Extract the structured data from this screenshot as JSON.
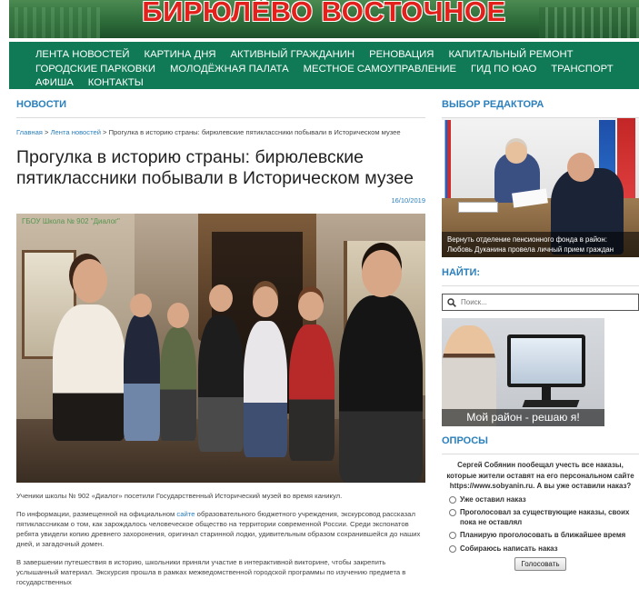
{
  "site": {
    "title": "БИРЮЛЁВО ВОСТОЧНОЕ"
  },
  "nav": {
    "rows": [
      [
        "Лента новостей",
        "Картина дня",
        "Активный гражданин",
        "Реновация",
        "Капитальный ремонт"
      ],
      [
        "Городские парковки",
        "Молодёжная палата",
        "Местное самоуправление",
        "Гид по ЮАО",
        "Транспорт"
      ],
      [
        "Афиша",
        "Контакты"
      ]
    ]
  },
  "main": {
    "section": "НОВОСТИ",
    "breadcrumb": {
      "home": "Главная",
      "sep1": " > ",
      "feed": "Лента новостей",
      "sep2": " > ",
      "current": "Прогулка в историю страны: бирюлевские пятиклассники побывали в Историческом музее"
    },
    "title": "Прогулка в историю страны: бирюлевские пятиклассники побывали в Историческом музее",
    "date": "16/10/2019",
    "photo_watermark": "ГБОУ Школа № 902 \"Диалог\"",
    "caption": "Ученики школы № 902 «Диалог» посетили Государственный Исторический музей во время каникул.",
    "para1_before": "По информации, размещенной на официальном ",
    "para1_link": "сайте",
    "para1_after": " образовательного бюджетного учреждения, экскурсовод рассказал пятиклассникам о том, как зарождалось человеческое общество на территории современной России. Среди экспонатов ребята увидели копию древнего захоронения, оригинал старинной лодки, удивительным образом сохранившейся до наших дней, и загадочный домен.",
    "para2": "В завершении путешествия в историю, школьники приняли участие в интерактивной викторине, чтобы закрепить услышанный материал. Экскурсия прошла в рамках межведомственной городской программы по изучению предмета в государственных"
  },
  "sidebar": {
    "editor_heading": "ВЫБОР РЕДАКТОРА",
    "editor_caption": "Вернуть отделение пенсионного фонда в район: Любовь Дуканина провела личный прием граждан",
    "search_heading": "НАЙТИ:",
    "search_placeholder": "Поиск...",
    "banner_text": "Мой район - решаю я!",
    "polls_heading": "ОПРОСЫ",
    "poll_question": "Сергей Собянин пообещал учесть все наказы, которые жители оставят на его персональном сайте https://www.sobyanin.ru. А вы уже оставили наказ?",
    "poll_options": [
      "Уже оставил наказ",
      "Проголосовал за существующие наказы, своих пока не оставлял",
      "Планирую проголосовать в ближайшее время",
      "Собираюсь написать наказ"
    ],
    "vote_label": "Голосовать"
  }
}
